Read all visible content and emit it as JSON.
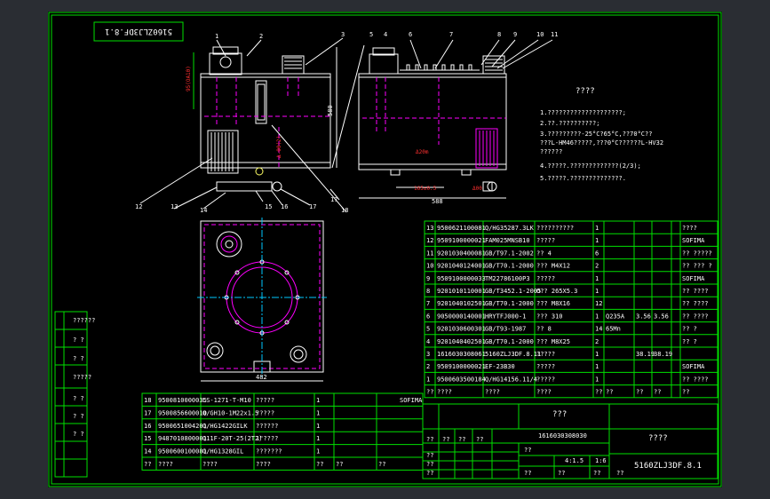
{
  "drawing_code_rotated": "5160ZLJ3DF.8.1",
  "title_center": "???",
  "title_right": "????",
  "drawing_number": "1616030308030",
  "drawing_code": "5160ZLJ3DF.8.1",
  "scale_a": "4:1.5",
  "scale_b": "1:6",
  "notes_title": "????",
  "notes": [
    "1.????????????????????;",
    "2.??.??????????;",
    "3.?????????-25°C?65°C,??70°C??",
    "  ???L-HM46?????,???0°C??????L-HV32",
    "  ??????",
    "4.?????.?????????????(2/3);",
    "5.?????.??????????????."
  ],
  "balloons_top": [
    "1",
    "2",
    "3",
    "5",
    "4",
    "6",
    "7",
    "8",
    "9",
    "10",
    "11"
  ],
  "balloons_bottom": [
    "12",
    "13",
    "14",
    "15",
    "16",
    "17",
    "18"
  ],
  "balloon_bottom_right": "17",
  "dims": {
    "d_side": "95(OA10)",
    "d_height": "580",
    "d_level": "Δ-00(2)",
    "d_width_side": "590",
    "d_width_front": "588",
    "d_oilport": "Δ20m",
    "d_front_a": "165±0.5",
    "d_front_b": "Δ00",
    "d_plan": "482"
  },
  "parts_list": [
    {
      "no": "13",
      "code": "9500621100081",
      "std": "Q/HG35287.3LK",
      "name": "??????????",
      "qty": "1",
      "mat": "",
      "w1": "",
      "w2": "",
      "note": "????"
    },
    {
      "no": "12",
      "code": "9509100000021",
      "std": "FAM025MNSB10",
      "name": "?????",
      "qty": "1",
      "mat": "",
      "w1": "",
      "w2": "",
      "note": "SOFIMA"
    },
    {
      "no": "11",
      "code": "9201030400081",
      "std": "GB/T97.1-2002",
      "name": "?? 4",
      "qty": "6",
      "mat": "",
      "w1": "",
      "w2": "",
      "note": "?? ?????"
    },
    {
      "no": "10",
      "code": "9201040124001",
      "std": "GB/T70.1-2000",
      "name": "??? M4X12",
      "qty": "2",
      "mat": "",
      "w1": "",
      "w2": "",
      "note": "?? ??? ?"
    },
    {
      "no": "9",
      "code": "9509100000033",
      "std": "TM22786100P3",
      "name": "?????",
      "qty": "1",
      "mat": "",
      "w1": "",
      "w2": "",
      "note": "SOFIMA"
    },
    {
      "no": "8",
      "code": "9201010110001",
      "std": "GB/T3452.1-2005",
      "name": "O?? 265X5.3",
      "qty": "1",
      "mat": "",
      "w1": "",
      "w2": "",
      "note": "?? ????"
    },
    {
      "no": "7",
      "code": "9201040102501",
      "std": "GB/T70.1-2000",
      "name": "??? M8X16",
      "qty": "12",
      "mat": "",
      "w1": "",
      "w2": "",
      "note": "?? ????"
    },
    {
      "no": "6",
      "code": "9050000140001",
      "std": "HRYTFJ000-1",
      "name": "??? 310",
      "qty": "1",
      "mat": "Q235A",
      "w1": "3.56",
      "w2": "3.56",
      "note": "?? ????"
    },
    {
      "no": "5",
      "code": "9201030600301",
      "std": "GB/T93-1987",
      "name": "?? 8",
      "qty": "14",
      "mat": "65Mn",
      "w1": "",
      "w2": "",
      "note": "?? ?"
    },
    {
      "no": "4",
      "code": "9201040402501",
      "std": "GB/T70.1-2000",
      "name": "??? M8X25",
      "qty": "2",
      "mat": "",
      "w1": "",
      "w2": "",
      "note": "?? ?"
    },
    {
      "no": "3",
      "code": "1616030308061",
      "std": "5160ZLJ3DF.8.11",
      "name": "?????",
      "qty": "1",
      "mat": "",
      "w1": "38.19",
      "w2": "38.19",
      "note": ""
    },
    {
      "no": "2",
      "code": "9509100000021",
      "std": "EF-23B30",
      "name": "?????",
      "qty": "1",
      "mat": "",
      "w1": "",
      "w2": "",
      "note": "SOFIMA"
    },
    {
      "no": "1",
      "code": "9500603500184",
      "std": "Q/HG14156.11/4",
      "name": "?????",
      "qty": "1",
      "mat": "",
      "w1": "",
      "w2": "",
      "note": "?? ????"
    }
  ],
  "parts_header": [
    "??",
    "????",
    "????",
    "????",
    "??",
    "??",
    "??",
    "??",
    "??"
  ],
  "lower_list": [
    {
      "no": "18",
      "code": "9500810000035",
      "std": "LS-1271-T-M10",
      "name": "?????",
      "qty": "1",
      "note": ""
    },
    {
      "no": "17",
      "code": "9500856600010",
      "std": "Q/GH10-1M22x1.5",
      "name": "?????",
      "qty": "1",
      "note": ""
    },
    {
      "no": "16",
      "code": "9500651004201",
      "std": "Q/HG1422GILK",
      "name": "??????",
      "qty": "1",
      "note": ""
    },
    {
      "no": "15",
      "code": "9487010800001",
      "std": "Q11F-20T-25(2T2)",
      "name": "1\"????",
      "qty": "1",
      "note": ""
    },
    {
      "no": "14",
      "code": "9500600100081",
      "std": "Q/HG1328GIL",
      "name": "???????",
      "qty": "1",
      "note": ""
    }
  ],
  "lower_header": [
    "??",
    "????",
    "????",
    "????",
    "??",
    "??",
    "??"
  ],
  "lower_note_label": "SOFIMA",
  "left_strip": [
    "??????",
    "? ?",
    "? ?",
    "?????",
    "? ?",
    "? ?",
    "? ?"
  ],
  "title_block_labels": [
    "??",
    "??",
    "??",
    "??",
    "??",
    "??",
    "??",
    "??",
    "??",
    "??",
    "??",
    "??"
  ],
  "colors": {
    "frame": "#00e000",
    "line": "#ffffff",
    "hidden": "#ff00ff",
    "accent": "#00c8ff",
    "background": "#000000"
  }
}
